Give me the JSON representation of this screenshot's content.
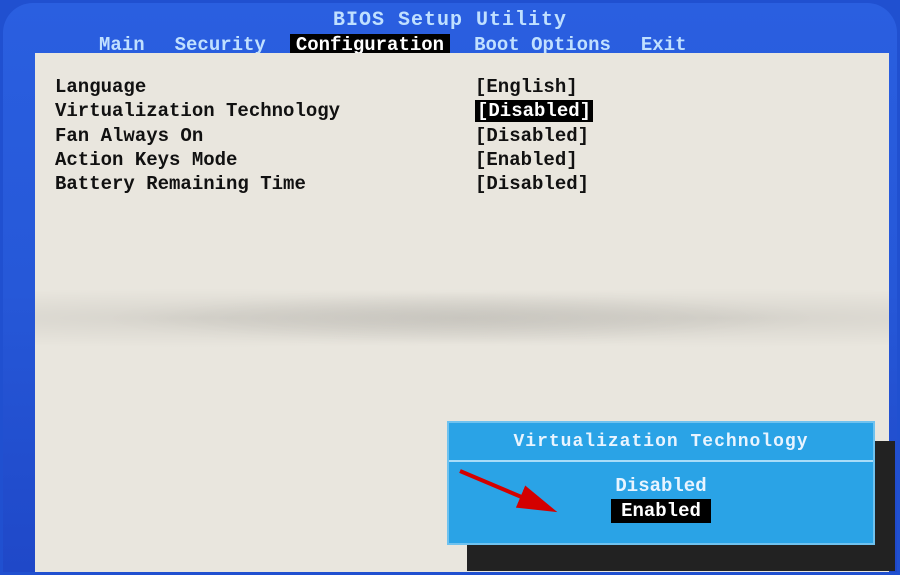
{
  "title": "BIOS Setup Utility",
  "tabs": {
    "main": "Main",
    "security": "Security",
    "configuration": "Configuration",
    "boot": "Boot Options",
    "exit": "Exit"
  },
  "settings": {
    "language": {
      "label": "Language",
      "value": "[English]"
    },
    "virtualization": {
      "label": "Virtualization Technology",
      "value": "[Disabled]"
    },
    "fan": {
      "label": "Fan Always On",
      "value": "[Disabled]"
    },
    "action_keys": {
      "label": "Action Keys Mode",
      "value": "[Enabled]"
    },
    "battery": {
      "label": "Battery Remaining Time",
      "value": "[Disabled]"
    }
  },
  "popup": {
    "title": "Virtualization Technology",
    "options": {
      "disabled": "Disabled",
      "enabled": "Enabled"
    }
  }
}
